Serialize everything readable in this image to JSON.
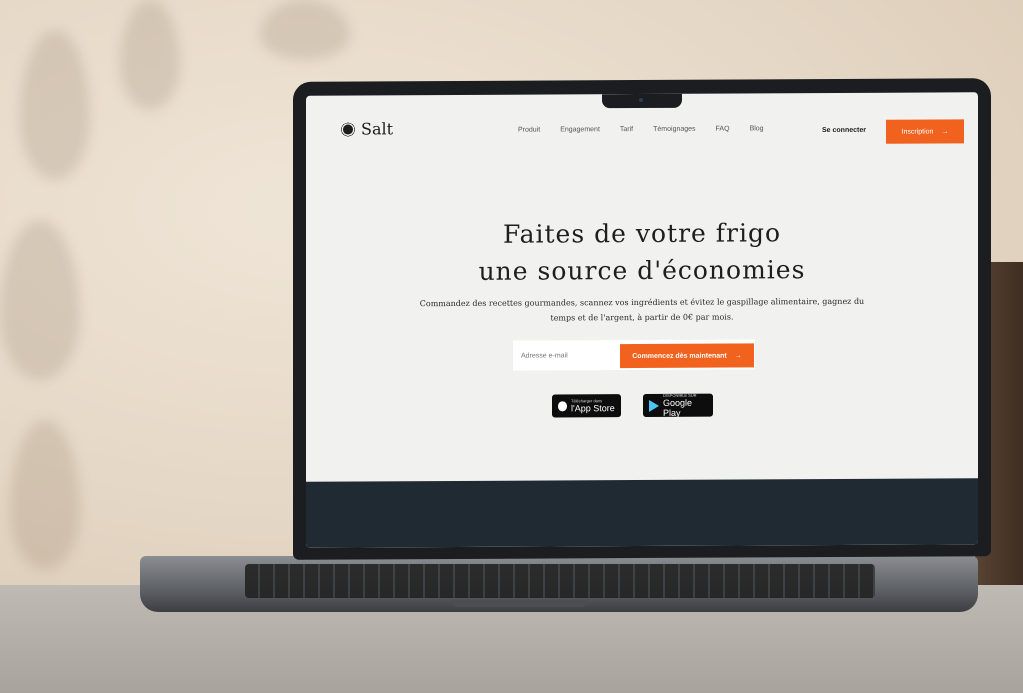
{
  "site": {
    "logo": "Salt",
    "nav": [
      "Produit",
      "Engagement",
      "Tarif",
      "Témoignages",
      "FAQ",
      "Blog"
    ],
    "login": "Se connecter",
    "signup": "Inscription",
    "arrow": "→"
  },
  "hero": {
    "title_line1": "Faites de votre frigo",
    "title_line2": "une source d'économies",
    "subtitle": "Commandez des recettes gourmandes, scannez vos ingrédients et évitez le gaspillage alimentaire, gagnez du temps et de l'argent, à partir de 0€ par mois.",
    "email_placeholder": "Adresse e-mail",
    "cta": "Commencez dès maintenant"
  },
  "badges": {
    "appstore_small": "Télécharger dans",
    "appstore_big": "l'App Store",
    "play_small": "DISPONIBLE SUR",
    "play_big": "Google Play"
  },
  "colors": {
    "accent": "#f2621f",
    "dark": "#1f2a33"
  }
}
